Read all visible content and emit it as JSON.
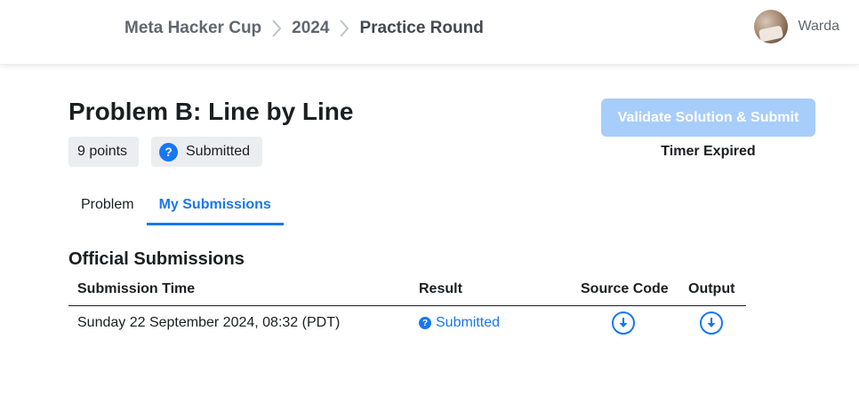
{
  "breadcrumb": {
    "items": [
      "Meta Hacker Cup",
      "2024",
      "Practice Round"
    ]
  },
  "user": {
    "name": "Warda"
  },
  "problem": {
    "title": "Problem B: Line by Line",
    "points": "9 points",
    "status": "Submitted"
  },
  "actions": {
    "submit_label": "Validate Solution & Submit",
    "timer_text": "Timer Expired"
  },
  "tabs": [
    {
      "label": "Problem",
      "active": false
    },
    {
      "label": "My Submissions",
      "active": true
    }
  ],
  "submissions": {
    "title": "Official Submissions",
    "columns": [
      "Submission Time",
      "Result",
      "Source Code",
      "Output"
    ],
    "rows": [
      {
        "time": "Sunday 22 September 2024, 08:32 (PDT)",
        "result": "Submitted"
      }
    ]
  },
  "colors": {
    "accent": "#1877f2",
    "button_disabled": "#a7cdfa",
    "chip_bg": "#ebedf0"
  },
  "icons": {
    "status": "question-circle-icon",
    "download": "download-circle-icon",
    "separator": "chevron-right-icon"
  }
}
